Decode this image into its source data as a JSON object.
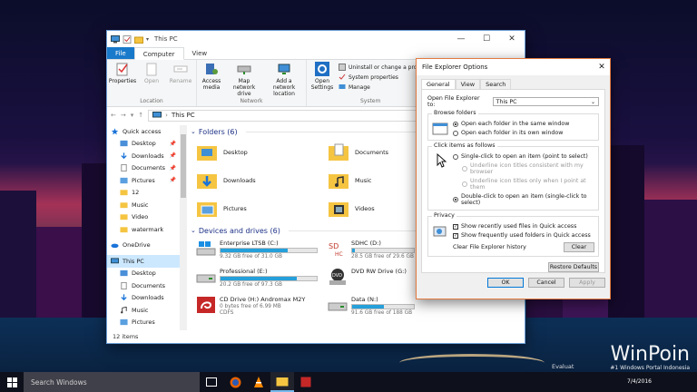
{
  "explorer": {
    "title": "This PC",
    "tabs": [
      "File",
      "Computer",
      "View"
    ],
    "ribbon": {
      "location": {
        "label": "Location",
        "buttons": [
          "Properties",
          "Open",
          "Rename"
        ]
      },
      "network": {
        "label": "Network",
        "buttons": [
          "Access media",
          "Map network drive",
          "Add a network location"
        ]
      },
      "system": {
        "label": "System",
        "open_settings": "Open Settings",
        "small": [
          "Uninstall or change a program",
          "System properties",
          "Manage"
        ]
      }
    },
    "address": {
      "path": "This PC"
    },
    "nav": {
      "quick_access": "Quick access",
      "quick_items": [
        "Desktop",
        "Downloads",
        "Documents",
        "Pictures",
        "12",
        "Music",
        "Video",
        "watermark"
      ],
      "onedrive": "OneDrive",
      "this_pc": "This PC",
      "pc_items": [
        "Desktop",
        "Documents",
        "Downloads",
        "Music",
        "Pictures"
      ]
    },
    "folders_header": "Folders (6)",
    "folders": [
      "Desktop",
      "Documents",
      "Downloads",
      "Music",
      "Pictures",
      "Videos"
    ],
    "drives_header": "Devices and drives (6)",
    "drives": [
      {
        "name": "Enterprise LTSB (C:)",
        "free": "9.32 GB free of 31.0 GB",
        "used": 0.7
      },
      {
        "name": "SDHC (D:)",
        "free": "28.5 GB free of 29.6 GB",
        "used": 0.04
      },
      {
        "name": "Professional (E:)",
        "free": "20.2 GB free of 97.3 GB",
        "used": 0.79
      },
      {
        "name": "DVD RW Drive (G:)",
        "free": "",
        "used": null
      },
      {
        "name": "CD Drive (H:) Andromax M2Y",
        "free": "0 bytes free of 6.99 MB",
        "sub": "CDFS",
        "used": null
      },
      {
        "name": "Data (N:)",
        "free": "91.6 GB free of 188 GB",
        "used": 0.51
      }
    ],
    "status": "12 items"
  },
  "dialog": {
    "title": "File Explorer Options",
    "tabs": [
      "General",
      "View",
      "Search"
    ],
    "open_label": "Open File Explorer to:",
    "open_value": "This PC",
    "browse": {
      "legend": "Browse folders",
      "opt1": "Open each folder in the same window",
      "opt2": "Open each folder in its own window"
    },
    "click": {
      "legend": "Click items as follows",
      "single": "Single-click to open an item (point to select)",
      "sub1": "Underline icon titles consistent with my browser",
      "sub2": "Underline icon titles only when I point at them",
      "double": "Double-click to open an item (single-click to select)"
    },
    "privacy": {
      "legend": "Privacy",
      "c1": "Show recently used files in Quick access",
      "c2": "Show frequently used folders in Quick access",
      "clear_label": "Clear File Explorer history",
      "clear_btn": "Clear"
    },
    "restore": "Restore Defaults",
    "ok": "OK",
    "cancel": "Cancel",
    "apply": "Apply"
  },
  "taskbar": {
    "search": "Search Windows",
    "date": "7/4/2016",
    "eval": "Evaluat"
  },
  "watermark": {
    "text": "WinPoin",
    "sub": "#1 Windows Portal Indonesia"
  }
}
